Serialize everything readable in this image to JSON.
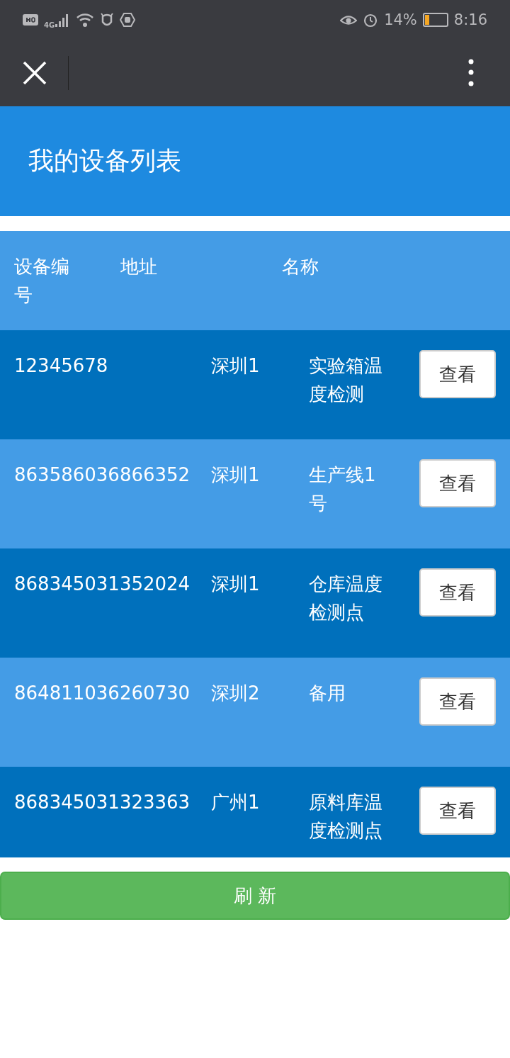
{
  "status_bar": {
    "network": "4G",
    "battery_text": "14%",
    "time": "8:16"
  },
  "page": {
    "title": "我的设备列表"
  },
  "table": {
    "columns": [
      "设备编号",
      "地址",
      "名称"
    ],
    "rows": [
      {
        "id": "12345678",
        "address": "深圳1",
        "name": "实验箱温度检测",
        "action": "查看"
      },
      {
        "id": "863586036866352",
        "address": "深圳1",
        "name": "生产线1号",
        "action": "查看"
      },
      {
        "id": "868345031352024",
        "address": "深圳1",
        "name": "仓库温度检测点",
        "action": "查看"
      },
      {
        "id": "864811036260730",
        "address": "深圳2",
        "name": "备用",
        "action": "查看"
      },
      {
        "id": "868345031323363",
        "address": "广州1",
        "name": "原料库温度检测点",
        "action": "查看"
      }
    ]
  },
  "refresh_button": "刷 新"
}
